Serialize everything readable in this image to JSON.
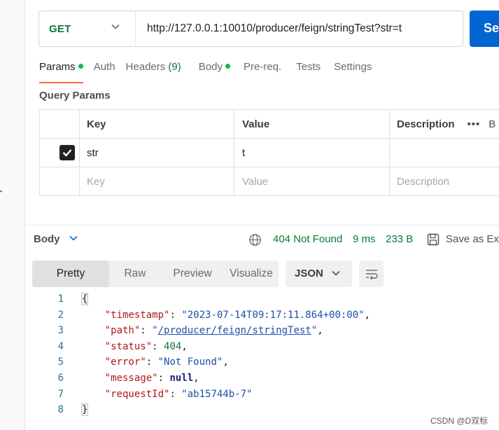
{
  "request": {
    "method": "GET",
    "url": "http://127.0.0.1:10010/producer/feign/stringTest?str=t",
    "send_label": "Se"
  },
  "tabs": [
    {
      "label": "Params",
      "dot": true,
      "active": true
    },
    {
      "label": "Auth"
    },
    {
      "label": "Headers",
      "count": "(9)"
    },
    {
      "label": "Body",
      "dot": true
    },
    {
      "label": "Pre-req."
    },
    {
      "label": "Tests"
    },
    {
      "label": "Settings"
    }
  ],
  "query_params": {
    "title": "Query Params",
    "headers": {
      "key": "Key",
      "value": "Value",
      "description": "Description",
      "more": "•••",
      "bulk": "B"
    },
    "rows": [
      {
        "checked": true,
        "key": "str",
        "value": "t",
        "description": ""
      }
    ],
    "placeholder": {
      "key": "Key",
      "value": "Value",
      "description": "Description"
    }
  },
  "response": {
    "body_label": "Body",
    "status": "404 Not Found",
    "time": "9 ms",
    "size": "233 B",
    "save_label": "Save as Ex",
    "views": [
      "Pretty",
      "Raw",
      "Preview",
      "Visualize"
    ],
    "active_view": "Pretty",
    "format": "JSON",
    "lines": [
      "1",
      "2",
      "3",
      "4",
      "5",
      "6",
      "7",
      "8"
    ],
    "json": {
      "timestamp": "2023-07-14T09:17:11.864+00:00",
      "path": "/producer/feign/stringTest",
      "status": "404",
      "error": "Not Found",
      "message": "null",
      "requestId": "ab15744b-7"
    }
  },
  "watermark": "CSDN @D双标",
  "colors": {
    "accent": "#ff6c37",
    "send": "#0265d2",
    "success": "#0a7a36"
  }
}
